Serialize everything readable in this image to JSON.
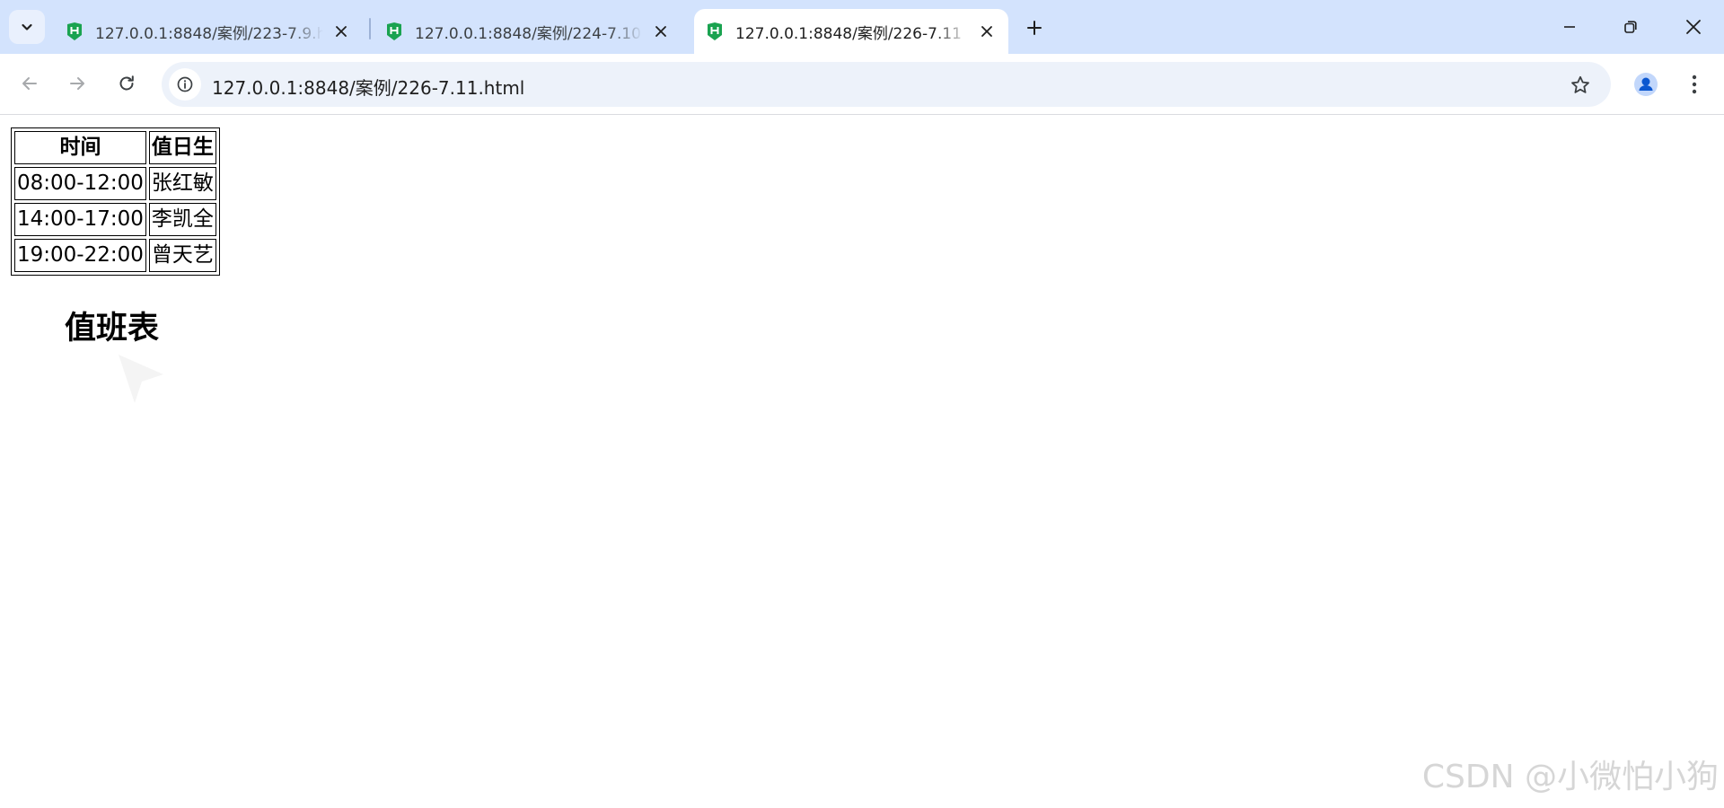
{
  "browser": {
    "tabs": [
      {
        "title": "127.0.0.1:8848/案例/223-7.9.h",
        "active": false,
        "favicon": "hbuilder-h-icon"
      },
      {
        "title": "127.0.0.1:8848/案例/224-7.10",
        "active": false,
        "favicon": "hbuilder-h-icon"
      },
      {
        "title": "127.0.0.1:8848/案例/226-7.11",
        "active": true,
        "favicon": "hbuilder-h-icon"
      }
    ],
    "address_bar": {
      "url": "127.0.0.1:8848/案例/226-7.11.html"
    },
    "colors": {
      "tabstrip_bg": "#d3e3fd",
      "omnibox_bg": "#edf2fa",
      "favicon_green": "#1aa350",
      "profile_blue": "#0b57d0"
    }
  },
  "page": {
    "table": {
      "headers": [
        "时间",
        "值日生"
      ],
      "rows": [
        [
          "08:00-12:00",
          "张红敏"
        ],
        [
          "14:00-17:00",
          "李凯全"
        ],
        [
          "19:00-22:00",
          "曾天艺"
        ]
      ]
    },
    "caption": "值班表",
    "watermark": "CSDN @小微怕小狗"
  }
}
